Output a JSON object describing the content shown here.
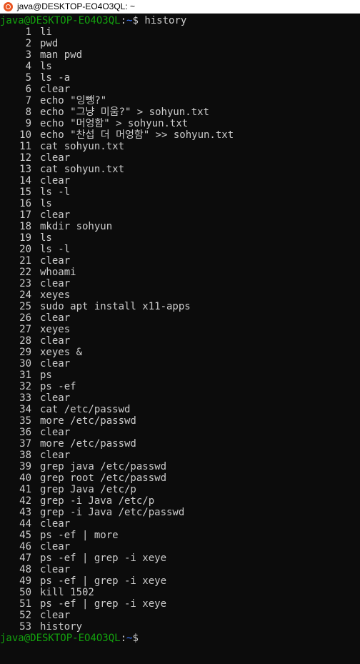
{
  "window": {
    "title": "java@DESKTOP-EO4O3QL: ~",
    "icon": "ubuntu-icon"
  },
  "prompt": {
    "user_host": "java@DESKTOP-EO4O3QL",
    "separator": ":",
    "path": "~",
    "symbol": "$"
  },
  "first_command": "history",
  "history": [
    {
      "n": "1",
      "cmd": "li"
    },
    {
      "n": "2",
      "cmd": "pwd"
    },
    {
      "n": "3",
      "cmd": "man pwd"
    },
    {
      "n": "4",
      "cmd": "ls"
    },
    {
      "n": "5",
      "cmd": "ls -a"
    },
    {
      "n": "6",
      "cmd": "clear"
    },
    {
      "n": "7",
      "cmd": "echo \"잉뺑?\""
    },
    {
      "n": "8",
      "cmd": "echo \"그냥 미움?\" > sohyun.txt"
    },
    {
      "n": "9",
      "cmd": "echo \"머엉함\" > sohyun.txt"
    },
    {
      "n": "10",
      "cmd": "echo \"찬섭 더 머엉함\" >> sohyun.txt"
    },
    {
      "n": "11",
      "cmd": "cat sohyun.txt"
    },
    {
      "n": "12",
      "cmd": "clear"
    },
    {
      "n": "13",
      "cmd": "cat sohyun.txt"
    },
    {
      "n": "14",
      "cmd": "clear"
    },
    {
      "n": "15",
      "cmd": "ls -l"
    },
    {
      "n": "16",
      "cmd": "ls"
    },
    {
      "n": "17",
      "cmd": "clear"
    },
    {
      "n": "18",
      "cmd": "mkdir sohyun"
    },
    {
      "n": "19",
      "cmd": "ls"
    },
    {
      "n": "20",
      "cmd": "ls -l"
    },
    {
      "n": "21",
      "cmd": "clear"
    },
    {
      "n": "22",
      "cmd": "whoami"
    },
    {
      "n": "23",
      "cmd": "clear"
    },
    {
      "n": "24",
      "cmd": "xeyes"
    },
    {
      "n": "25",
      "cmd": "sudo apt install x11-apps"
    },
    {
      "n": "26",
      "cmd": "clear"
    },
    {
      "n": "27",
      "cmd": "xeyes"
    },
    {
      "n": "28",
      "cmd": "clear"
    },
    {
      "n": "29",
      "cmd": "xeyes &"
    },
    {
      "n": "30",
      "cmd": "clear"
    },
    {
      "n": "31",
      "cmd": "ps"
    },
    {
      "n": "32",
      "cmd": "ps -ef"
    },
    {
      "n": "33",
      "cmd": "clear"
    },
    {
      "n": "34",
      "cmd": "cat /etc/passwd"
    },
    {
      "n": "35",
      "cmd": "more /etc/passwd"
    },
    {
      "n": "36",
      "cmd": "clear"
    },
    {
      "n": "37",
      "cmd": "more /etc/passwd"
    },
    {
      "n": "38",
      "cmd": "clear"
    },
    {
      "n": "39",
      "cmd": "grep java /etc/passwd"
    },
    {
      "n": "40",
      "cmd": "grep root /etc/passwd"
    },
    {
      "n": "41",
      "cmd": "grep Java /etc/p"
    },
    {
      "n": "42",
      "cmd": "grep -i Java /etc/p"
    },
    {
      "n": "43",
      "cmd": "grep -i Java /etc/passwd"
    },
    {
      "n": "44",
      "cmd": "clear"
    },
    {
      "n": "45",
      "cmd": "ps -ef | more"
    },
    {
      "n": "46",
      "cmd": "clear"
    },
    {
      "n": "47",
      "cmd": "ps -ef | grep -i xeye"
    },
    {
      "n": "48",
      "cmd": "clear"
    },
    {
      "n": "49",
      "cmd": "ps -ef | grep -i xeye"
    },
    {
      "n": "50",
      "cmd": "kill 1502"
    },
    {
      "n": "51",
      "cmd": "ps -ef | grep -i xeye"
    },
    {
      "n": "52",
      "cmd": "clear"
    },
    {
      "n": "53",
      "cmd": "history"
    }
  ],
  "colors": {
    "background": "#0c0c0c",
    "text": "#cccccc",
    "user_host": "#13a10e",
    "path": "#3b78ff",
    "icon": "#e95420"
  }
}
